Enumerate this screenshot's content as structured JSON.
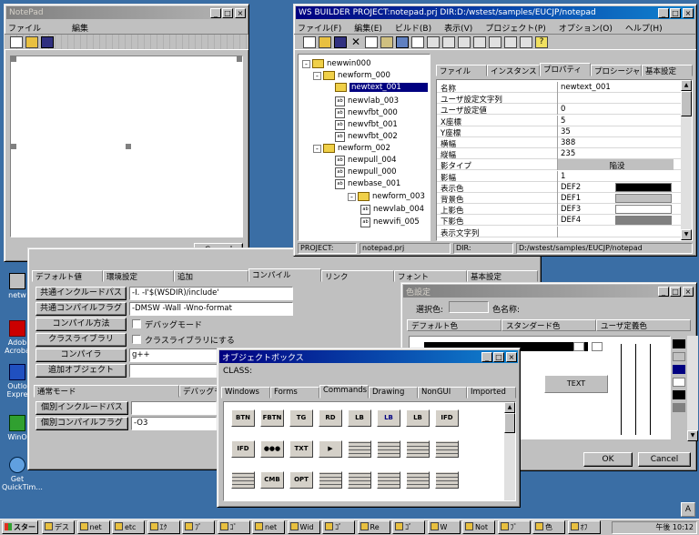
{
  "notepad": {
    "title": "NotePad",
    "menu": [
      "ファイル",
      "編集"
    ],
    "cancel": "Cancel"
  },
  "builder": {
    "title": "WS BUILDER PROJECT:notepad.prj DIR:D:/wstest/samples/EUCJP/notepad",
    "menu": [
      "ファイル(F)",
      "編集(E)",
      "ビルド(B)",
      "表示(V)",
      "プロジェクト(P)",
      "オプション(O)",
      "ヘルプ(H)"
    ],
    "tree": [
      {
        "label": "newwin000",
        "kind": "folder",
        "level": 0
      },
      {
        "label": "newform_000",
        "kind": "folder",
        "level": 1
      },
      {
        "label": "newtext_001",
        "kind": "folder",
        "level": 2,
        "selected": true
      },
      {
        "label": "newvlab_003",
        "kind": "doc",
        "level": 2
      },
      {
        "label": "newvfbt_000",
        "kind": "doc",
        "level": 2
      },
      {
        "label": "newvfbt_001",
        "kind": "doc",
        "level": 2
      },
      {
        "label": "newvfbt_002",
        "kind": "doc",
        "level": 2
      },
      {
        "label": "newform_002",
        "kind": "folder",
        "level": 1
      },
      {
        "label": "newpull_004",
        "kind": "doc",
        "level": 2
      },
      {
        "label": "newpull_000",
        "kind": "doc",
        "level": 2
      },
      {
        "label": "newbase_001",
        "kind": "doc",
        "level": 2
      },
      {
        "label": "newform_003",
        "kind": "folder",
        "level": 3
      },
      {
        "label": "newvlab_004",
        "kind": "doc",
        "level": 4
      },
      {
        "label": "newvifi_005",
        "kind": "doc",
        "level": 4
      }
    ],
    "tabs": [
      "ファイル",
      "インスタンス",
      "プロパティ",
      "プロシージャ",
      "基本設定"
    ],
    "props": [
      {
        "k": "名称",
        "v": "newtext_001"
      },
      {
        "k": "ユーザ設定文字列",
        "v": ""
      },
      {
        "k": "ユーザ設定値",
        "v": "0"
      },
      {
        "k": "X座標",
        "v": "5"
      },
      {
        "k": "Y座標",
        "v": "35"
      },
      {
        "k": "横幅",
        "v": "388"
      },
      {
        "k": "縦幅",
        "v": "235"
      },
      {
        "k": "影タイプ",
        "v": "陥没"
      },
      {
        "k": "影幅",
        "v": "1"
      },
      {
        "k": "表示色",
        "v": "DEF2"
      },
      {
        "k": "背景色",
        "v": "DEF1"
      },
      {
        "k": "上影色",
        "v": "DEF3"
      },
      {
        "k": "下影色",
        "v": "DEF4"
      },
      {
        "k": "表示文字列",
        "v": ""
      }
    ],
    "status_project_label": "PROJECT:",
    "status_project": "notepad.prj",
    "status_dir_label": "DIR:",
    "status_dir": "D:/wstest/samples/EUCJP/notepad"
  },
  "compile": {
    "tabs": [
      "デフォルト値",
      "環境設定",
      "追加",
      "コンパイル",
      "リンク",
      "フォント",
      "基本設定"
    ],
    "rows": [
      {
        "label": "共通インクルードパス",
        "value": "-I. -I'$(WSDIR)/include'"
      },
      {
        "label": "共通コンパイルフラグ",
        "value": "-DMSW -Wall -Wno-format"
      },
      {
        "label": "コンパイル方法",
        "check": "デバッグモード"
      },
      {
        "label": "クラスライブラリ",
        "check": "クラスライブラリにする"
      },
      {
        "label": "コンパイラ",
        "value": "g++"
      },
      {
        "label": "追加オブジェクト",
        "value": ""
      }
    ],
    "subtabs": [
      "通常モード",
      "デバッグモ"
    ],
    "subrows": [
      {
        "label": "個別インクルードパス",
        "value": ""
      },
      {
        "label": "個別コンパイルフラグ",
        "value": "-O3"
      }
    ]
  },
  "color": {
    "title": "色設定",
    "selected_label": "選択色:",
    "name_label": "色名称:",
    "cols": [
      "デフォルト色",
      "スタンダード色",
      "ユーザ定義色"
    ],
    "sample_text": "TEXT",
    "ok": "OK",
    "cancel": "Cancel",
    "colors": {
      "black": "#000000",
      "navy": "#000080"
    }
  },
  "objbox": {
    "title": "オブジェクトボックス",
    "class_label": "CLASS:",
    "tabs": [
      "Windows",
      "Forms",
      "Commands",
      "Drawing",
      "NonGUI",
      "Imported"
    ],
    "row1": [
      "BTN",
      "FBTN",
      "TG",
      "RD",
      "LB",
      "LB",
      "LB",
      "IFD"
    ],
    "row2": [
      "IFD",
      "●●●",
      "TXT",
      "▶",
      "",
      "",
      "",
      ""
    ],
    "row3": [
      "",
      "CMB",
      "OPT",
      "",
      "",
      "",
      "",
      ""
    ]
  },
  "desktop": [
    {
      "label": "netw"
    },
    {
      "label": "Adob Acroba"
    },
    {
      "label": "Outlo Expre"
    },
    {
      "label": "WinO"
    },
    {
      "label": "Get QuickTim..."
    }
  ],
  "taskbar": {
    "start": "スタート",
    "items": [
      "デス",
      "net",
      "etc",
      "ｴｸ",
      "ﾌﾞ",
      "ｺﾞ",
      "net",
      "Wid",
      "ｺﾞ",
      "Re",
      "ｺﾞ",
      "W",
      "Not",
      "ﾌﾞ",
      "色",
      "ｵﾌ"
    ],
    "clock": "午後 10:12",
    "ime": "A"
  }
}
